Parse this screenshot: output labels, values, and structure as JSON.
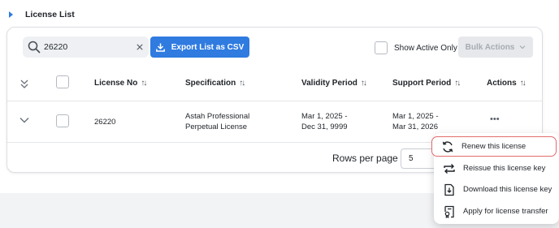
{
  "section": {
    "title": "License List"
  },
  "toolbar": {
    "search_value": "26220",
    "export_label": "Export List as CSV",
    "show_active_label": "Show Active Only",
    "bulk_actions_label": "Bulk Actions"
  },
  "table": {
    "columns": [
      {
        "label": "License No",
        "sortable": true
      },
      {
        "label": "Specification",
        "sortable": true
      },
      {
        "label": "Validity Period",
        "sortable": true
      },
      {
        "label": "Support Period",
        "sortable": true
      },
      {
        "label": "Actions",
        "sortable": true
      }
    ],
    "rows": [
      {
        "license_no": "26220",
        "specification_line1": "Astah Professional",
        "specification_line2": "Perpetual License",
        "validity_line1": "Mar 1, 2025 -",
        "validity_line2": "Dec 31, 9999",
        "support_line1": "Mar 1, 2025 -",
        "support_line2": "Mar 31, 2026",
        "actions": "•••"
      }
    ]
  },
  "pagination": {
    "rows_per_page_label": "Rows per page",
    "rows_per_page_value": "5"
  },
  "actions_menu": {
    "items": [
      {
        "label": "Renew this license",
        "icon": "renew-icon",
        "highlighted": true
      },
      {
        "label": "Reissue this license key",
        "icon": "reissue-icon"
      },
      {
        "label": "Download this license key",
        "icon": "download-file-icon"
      },
      {
        "label": "Apply for license transfer",
        "icon": "transfer-certificate-icon"
      }
    ]
  },
  "colors": {
    "accent": "#2f7be0",
    "highlight_border": "#e26b6b"
  }
}
